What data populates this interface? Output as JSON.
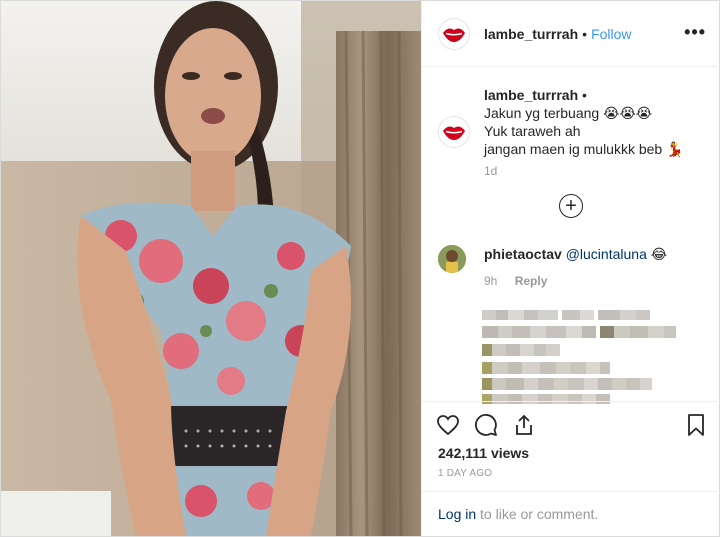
{
  "post": {
    "username": "lambe_turrrah",
    "separator": "•",
    "follow_label": "Follow",
    "more_label": "•••"
  },
  "caption": {
    "username": "lambe_turrrah",
    "bullet": "•",
    "line1": "Jakun yg terbuang 😭😭😭",
    "line2": "Yuk taraweh ah",
    "line3": "jangan maen ig mulukkk beb 💃",
    "time": "1d"
  },
  "load_more": {
    "label": "+"
  },
  "comment": {
    "username": "phietaoctav",
    "mention": "@lucintaluna",
    "emoji": "😂",
    "time": "9h",
    "reply_label": "Reply"
  },
  "stats": {
    "views": "242,111 views",
    "posted": "1 DAY AGO"
  },
  "login_prompt": {
    "link": "Log in",
    "rest": " to like or comment."
  },
  "icons": {
    "more": "more-options-icon",
    "like": "heart-icon",
    "comment": "comment-icon",
    "share": "share-icon",
    "save": "bookmark-icon",
    "load_more": "plus-circle-icon"
  },
  "colors": {
    "link_blue": "#3897f0",
    "dark_link": "#003569",
    "muted": "#999999",
    "text": "#262626",
    "brand_red": "#d0021b"
  }
}
